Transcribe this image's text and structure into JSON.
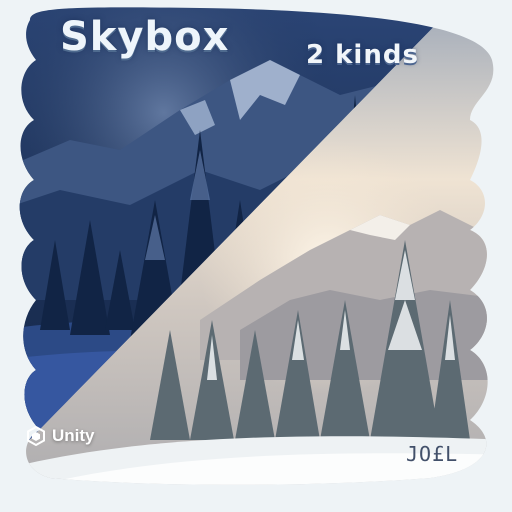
{
  "title": "Skybox",
  "subtitle": "2 kinds",
  "engine": {
    "label": "Unity",
    "icon": "unity-logo-icon"
  },
  "brand": {
    "logo_text": "JO£L",
    "sub": ""
  },
  "scenes": [
    {
      "name": "night",
      "icon": "night-mountain-scene"
    },
    {
      "name": "day",
      "icon": "day-mountain-scene"
    }
  ],
  "colors": {
    "background": "#eef3f6",
    "night_sky": "#1c2f55",
    "day_sky": "#d9cfc3",
    "snow": "#eef2f4"
  }
}
